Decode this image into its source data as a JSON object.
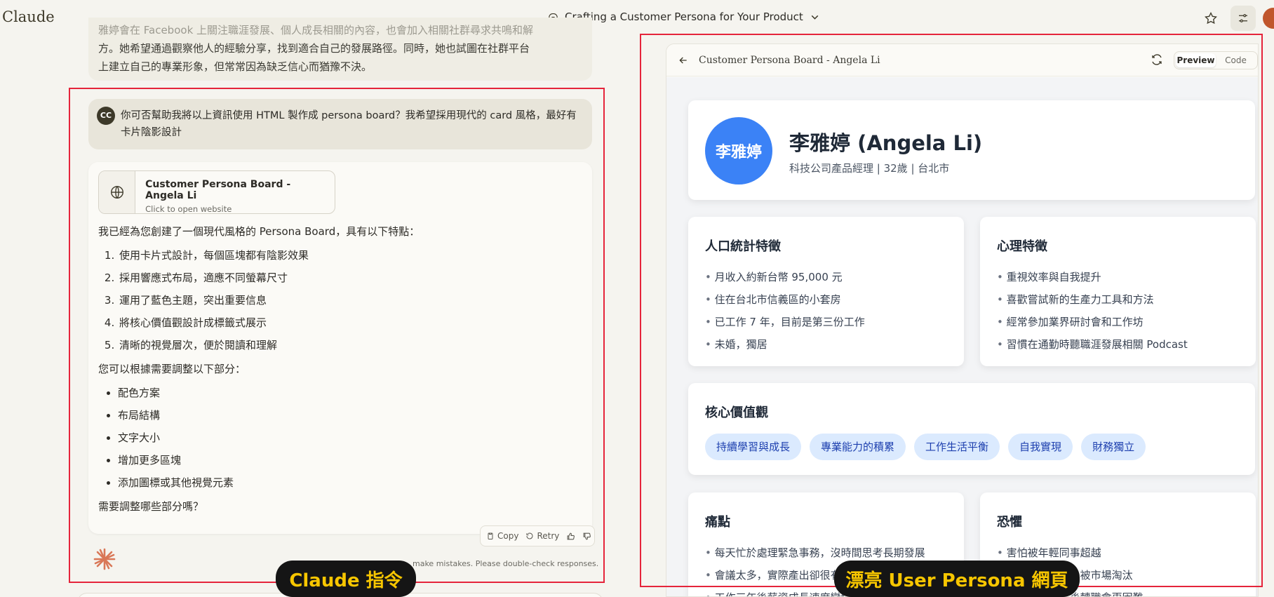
{
  "app": {
    "logo": "Claude"
  },
  "header": {
    "conversation_title": "Crafting a Customer Persona for Your Product"
  },
  "previous_message": {
    "lines": [
      "雅婷會在 Facebook 上關注職涯發展、個人成長相關的內容，也會加入相關社群尋求共鳴和解",
      "方。她希望通過觀察他人的經驗分享，找到適合自己的發展路徑。同時，她也試圖在社群平台",
      "上建立自己的專業形象，但常常因為缺乏信心而猶豫不決。"
    ]
  },
  "user_message": {
    "avatar": "CC",
    "text": "你可否幫助我將以上資訊使用 HTML 製作成 persona board？我希望採用現代的 card 風格，最好有卡片陰影設計"
  },
  "response": {
    "artifact_title": "Customer Persona Board - Angela Li",
    "artifact_sub": "Click to open website",
    "intro": "我已經為您創建了一個現代風格的 Persona Board，具有以下特點：",
    "features": [
      "使用卡片式設計，每個區塊都有陰影效果",
      "採用響應式布局，適應不同螢幕尺寸",
      "運用了藍色主題，突出重要信息",
      "將核心價值觀設計成標籤式展示",
      "清晰的視覺層次，便於閱讀和理解"
    ],
    "adjust_intro": "您可以根據需要調整以下部分：",
    "adjust_items": [
      "配色方案",
      "布局結構",
      "文字大小",
      "增加更多區塊",
      "添加圖標或其他視覺元素"
    ],
    "closing": "需要調整哪些部分嗎？",
    "copy_label": "Copy",
    "retry_label": "Retry"
  },
  "disclaimer": "make mistakes. Please double-check responses.",
  "panel": {
    "title": "Customer Persona Board - Angela Li",
    "preview_label": "Preview",
    "code_label": "Code"
  },
  "persona": {
    "avatar_text": "李雅婷",
    "name": "李雅婷 (Angela Li)",
    "subtitle": "科技公司產品經理 | 32歲 | 台北市",
    "demographics": {
      "title": "人口統計特徵",
      "items": [
        "月收入約新台幣 95,000 元",
        "住在台北市信義區的小套房",
        "已工作 7 年，目前是第三份工作",
        "未婚，獨居"
      ]
    },
    "psychology": {
      "title": "心理特徵",
      "items": [
        "重視效率與自我提升",
        "喜歡嘗試新的生產力工具和方法",
        "經常參加業界研討會和工作坊",
        "習慣在通勤時聽職涯發展相關 Podcast"
      ]
    },
    "values": {
      "title": "核心價值觀",
      "tags": [
        "持續學習與成長",
        "專業能力的積累",
        "工作生活平衡",
        "自我實現",
        "財務獨立"
      ]
    },
    "pain": {
      "title": "痛點",
      "items": [
        "每天忙於處理緊急事務，沒時間思考長期發展",
        "會議太多，實際產出卻很有限",
        "工作三年後薪資成長速度變緩"
      ]
    },
    "fear": {
      "title": "恐懼",
      "items": [
        "害怕被年輕同事超越",
        "擔心技能跟不上被市場淘汰",
        "害怕年紀漸長後轉職會更困難"
      ]
    }
  },
  "annotations": {
    "left_label": "Claude 指令",
    "right_label": "漂亮 User Persona 網頁"
  }
}
